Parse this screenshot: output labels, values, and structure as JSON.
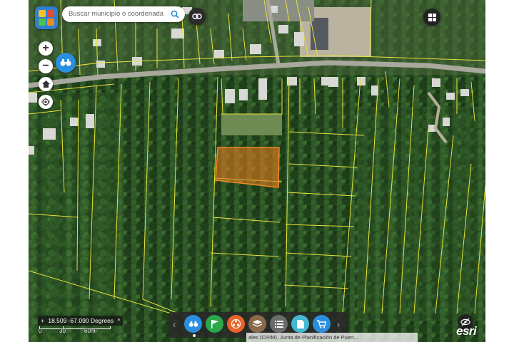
{
  "search": {
    "placeholder": "Buscar municipio o coordenada"
  },
  "coordinates": {
    "lat": "18.509",
    "lon": "-67.090",
    "unit": "Degrees"
  },
  "scale": {
    "labels": [
      "0",
      "30",
      "60mi"
    ]
  },
  "attribution": "ales (CRIM), Junta de Planificación de Puert...",
  "brand": "esri",
  "colors": {
    "parcel_line": "#e8e23a",
    "selected_parcel": "#e07a1f",
    "road": "#9a9a8f",
    "forest": "#2a4d24",
    "accent": "#2b8fe0"
  },
  "toolbar": {
    "buttons": [
      {
        "name": "binoculars",
        "color": "#2b8fe0"
      },
      {
        "name": "flag",
        "color": "#2aa84a"
      },
      {
        "name": "film",
        "color": "#e8642a"
      },
      {
        "name": "layers",
        "color": "#8a6a4a"
      },
      {
        "name": "list",
        "color": "#6b6b6b"
      },
      {
        "name": "document",
        "color": "#45b7d1"
      },
      {
        "name": "cart",
        "color": "#2b8fe0"
      }
    ]
  }
}
